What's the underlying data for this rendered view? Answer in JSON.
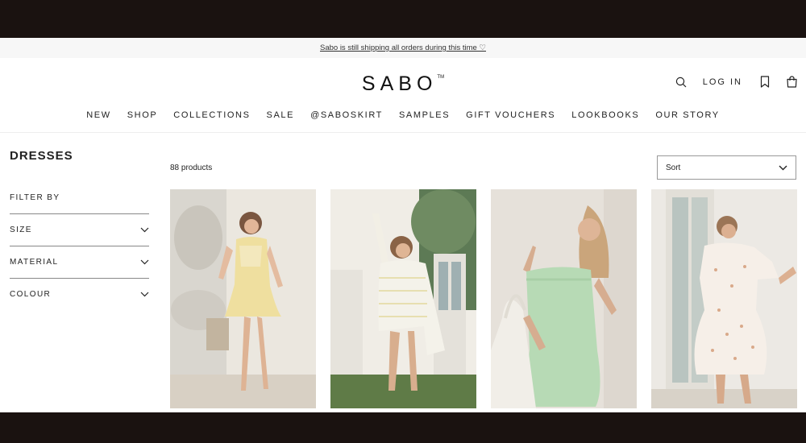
{
  "announcement": "Sabo is still shipping all orders during this time ♡",
  "brand": {
    "name": "SABO",
    "mark": "TM"
  },
  "header": {
    "search_icon": "search-icon",
    "login_label": "LOG IN",
    "wishlist_icon": "bookmark-icon",
    "cart_icon": "shopping-bag-icon"
  },
  "nav": [
    "NEW",
    "SHOP",
    "COLLECTIONS",
    "SALE",
    "@SABOSKIRT",
    "SAMPLES",
    "GIFT VOUCHERS",
    "LOOKBOOKS",
    "OUR STORY"
  ],
  "collection": {
    "title": "DRESSES",
    "count_label": "88 products"
  },
  "filters": {
    "heading": "FILTER BY",
    "items": [
      "SIZE",
      "MATERIAL",
      "COLOUR"
    ]
  },
  "sort": {
    "label": "Sort"
  },
  "products": [
    {
      "image": "woman in yellow floral puff-sleeve mini dress beside stone fountain",
      "colors": [
        "#e9e4d8",
        "#efe0b0",
        "#c9b7a3"
      ]
    },
    {
      "image": "woman in white striped wrap mini dress in garden",
      "colors": [
        "#6c8468",
        "#f1efe6",
        "#c8a88a"
      ]
    },
    {
      "image": "woman in mint green strappy mini dress holding tote bag",
      "colors": [
        "#e7e2dc",
        "#b9dcb9",
        "#d3b7a0"
      ]
    },
    {
      "image": "woman in white floral ruffle mini dress by window",
      "colors": [
        "#eceae6",
        "#f4ede6",
        "#d2b19a"
      ]
    }
  ]
}
